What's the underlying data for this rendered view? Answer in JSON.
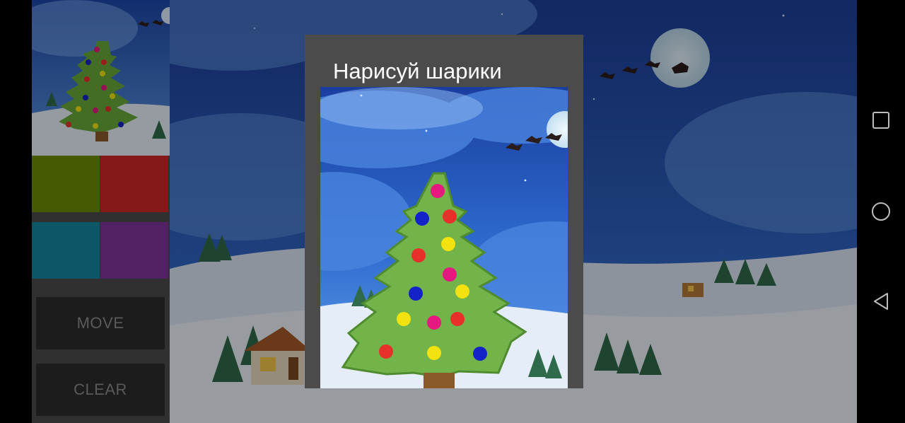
{
  "dialog": {
    "title": "Нарисуй шарики"
  },
  "controls": {
    "move_label": "MOVE",
    "clear_label": "CLEAR"
  },
  "palette": [
    {
      "name": "olive",
      "color": "#6b8a06"
    },
    {
      "name": "red",
      "color": "#cc2727"
    },
    {
      "name": "teal",
      "color": "#1585a0"
    },
    {
      "name": "purple",
      "color": "#7d3398"
    }
  ],
  "ornament_colors": {
    "magenta": "#e5197e",
    "red": "#e8302a",
    "yellow": "#f2e20f",
    "blue": "#1423c8"
  },
  "navigation": {
    "recents": "recents-icon",
    "home": "home-icon",
    "back": "back-icon"
  }
}
